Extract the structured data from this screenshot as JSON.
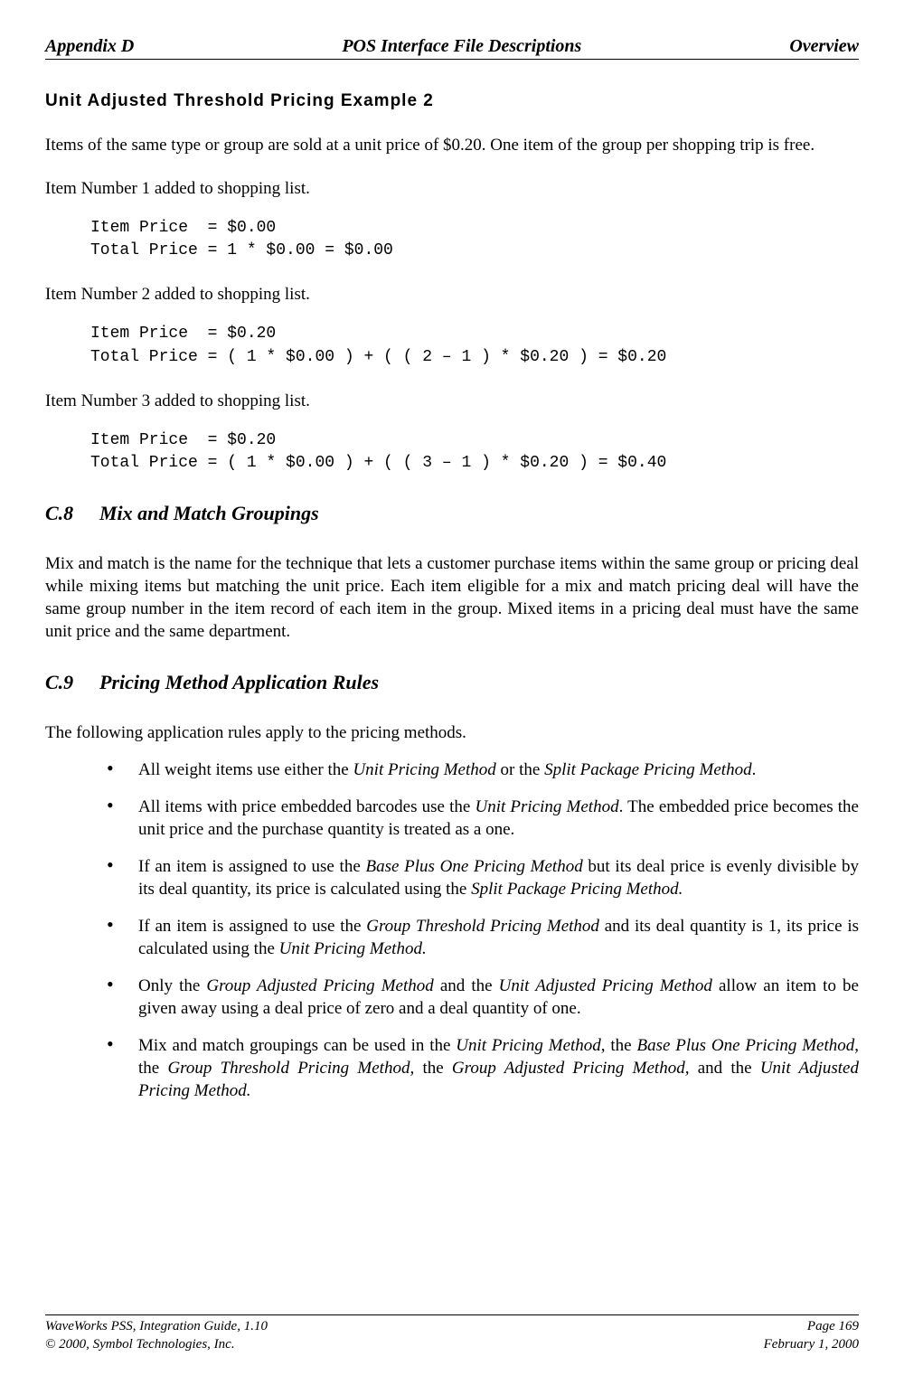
{
  "header": {
    "left": "Appendix D",
    "center": "POS Interface File Descriptions",
    "right": "Overview"
  },
  "section_heading": "Unit Adjusted Threshold Pricing Example 2",
  "intro": "Items of the same type or group are sold at a unit price of $0.20.  One item of the group per shopping trip is free.",
  "items": [
    {
      "label": "Item Number 1 added to shopping list.",
      "mono": "Item Price  = $0.00\nTotal Price = 1 * $0.00 = $0.00"
    },
    {
      "label": "Item Number 2 added to shopping list.",
      "mono": "Item Price  = $0.20\nTotal Price = ( 1 * $0.00 ) + ( ( 2 – 1 ) * $0.20 ) = $0.20"
    },
    {
      "label": "Item Number 3 added to shopping list.",
      "mono": "Item Price  = $0.20\nTotal Price = ( 1 * $0.00 ) + ( ( 3 – 1 ) * $0.20 ) = $0.40"
    }
  ],
  "c8": {
    "num": "C.8",
    "title": "Mix and Match Groupings",
    "para": "Mix and match is the name for the technique that lets a customer purchase items within the same group or pricing deal while mixing items but matching the unit price.   Each item eligible for a mix and match pricing deal will have the same group number in the item record of each item in the group.  Mixed items in a pricing deal must have the same unit price and the same department."
  },
  "c9": {
    "num": "C.9",
    "title": "Pricing Method Application Rules",
    "intro": "The following application rules apply to the pricing methods.",
    "bullets": {
      "b0": {
        "t1": "All weight items use either the ",
        "i1": "Unit Pricing Method",
        "t2": " or the ",
        "i2": "Split Package Pricing Method",
        "t3": "."
      },
      "b1": {
        "t1": "All items with price embedded barcodes use the ",
        "i1": "Unit Pricing Method",
        "t2": ".  The embedded price becomes the unit price and the purchase quantity is treated as a one."
      },
      "b2": {
        "t1": "If an item is assigned to use the ",
        "i1": "Base Plus One Pricing Method",
        "t2": " but its deal price is evenly divisible by its deal quantity, its price is calculated using the ",
        "i2": "Split Package Pricing Method."
      },
      "b3": {
        "t1": "If an item is assigned to use the ",
        "i1": "Group Threshold Pricing Method",
        "t2": " and its deal quantity is 1, its price is calculated using the ",
        "i2": "Unit Pricing Method."
      },
      "b4": {
        "t1": "Only the ",
        "i1": "Group Adjusted Pricing Method",
        "t2": " and the ",
        "i2": "Unit Adjusted Pricing Method",
        "t3": " allow an item to be given away using a deal price of zero and a deal quantity of one."
      },
      "b5": {
        "t1": "Mix and match groupings can be used in the ",
        "i1": "Unit Pricing Method",
        "t2": ", the ",
        "i2": "Base Plus One Pricing Method",
        "t3": ", the ",
        "i3": "Group Threshold Pricing Method,",
        "t4": " the ",
        "i4": "Group Adjusted Pricing Method,",
        "t5": " and the ",
        "i5": "Unit Adjusted Pricing Method."
      }
    }
  },
  "footer": {
    "left1": "WaveWorks PSS, Integration Guide, 1.10",
    "left2": "© 2000, Symbol Technologies, Inc.",
    "right1": "Page 169",
    "right2": "February 1, 2000"
  }
}
